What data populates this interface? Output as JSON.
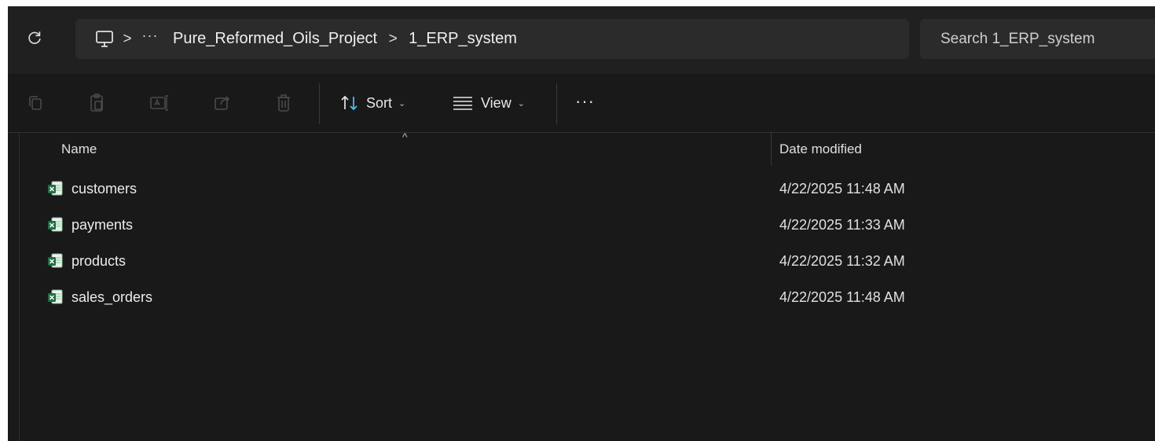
{
  "address_bar": {
    "refresh_icon": "refresh-icon",
    "pc_icon": "computer-icon",
    "separator": ">",
    "more": "···",
    "path": [
      "Pure_Reformed_Oils_Project",
      "1_ERP_system"
    ]
  },
  "search": {
    "placeholder": "Search 1_ERP_system"
  },
  "command_bar": {
    "icons": [
      "copy-icon",
      "paste-icon",
      "rename-icon",
      "share-icon",
      "delete-icon"
    ],
    "sort_label": "Sort",
    "view_label": "View",
    "more_label": "···"
  },
  "columns": {
    "name": "Name",
    "date_modified": "Date modified",
    "sort_caret": "^"
  },
  "files": [
    {
      "name": "customers",
      "date": "4/22/2025 11:48 AM",
      "icon": "excel-file-icon"
    },
    {
      "name": "payments",
      "date": "4/22/2025 11:33 AM",
      "icon": "excel-file-icon"
    },
    {
      "name": "products",
      "date": "4/22/2025 11:32 AM",
      "icon": "excel-file-icon"
    },
    {
      "name": "sales_orders",
      "date": "4/22/2025 11:48 AM",
      "icon": "excel-file-icon"
    }
  ],
  "colors": {
    "background": "#191919",
    "bar": "#202020",
    "field": "#2b2b2b",
    "accent": "#4cc2ff",
    "excel": "#1d6f42"
  }
}
